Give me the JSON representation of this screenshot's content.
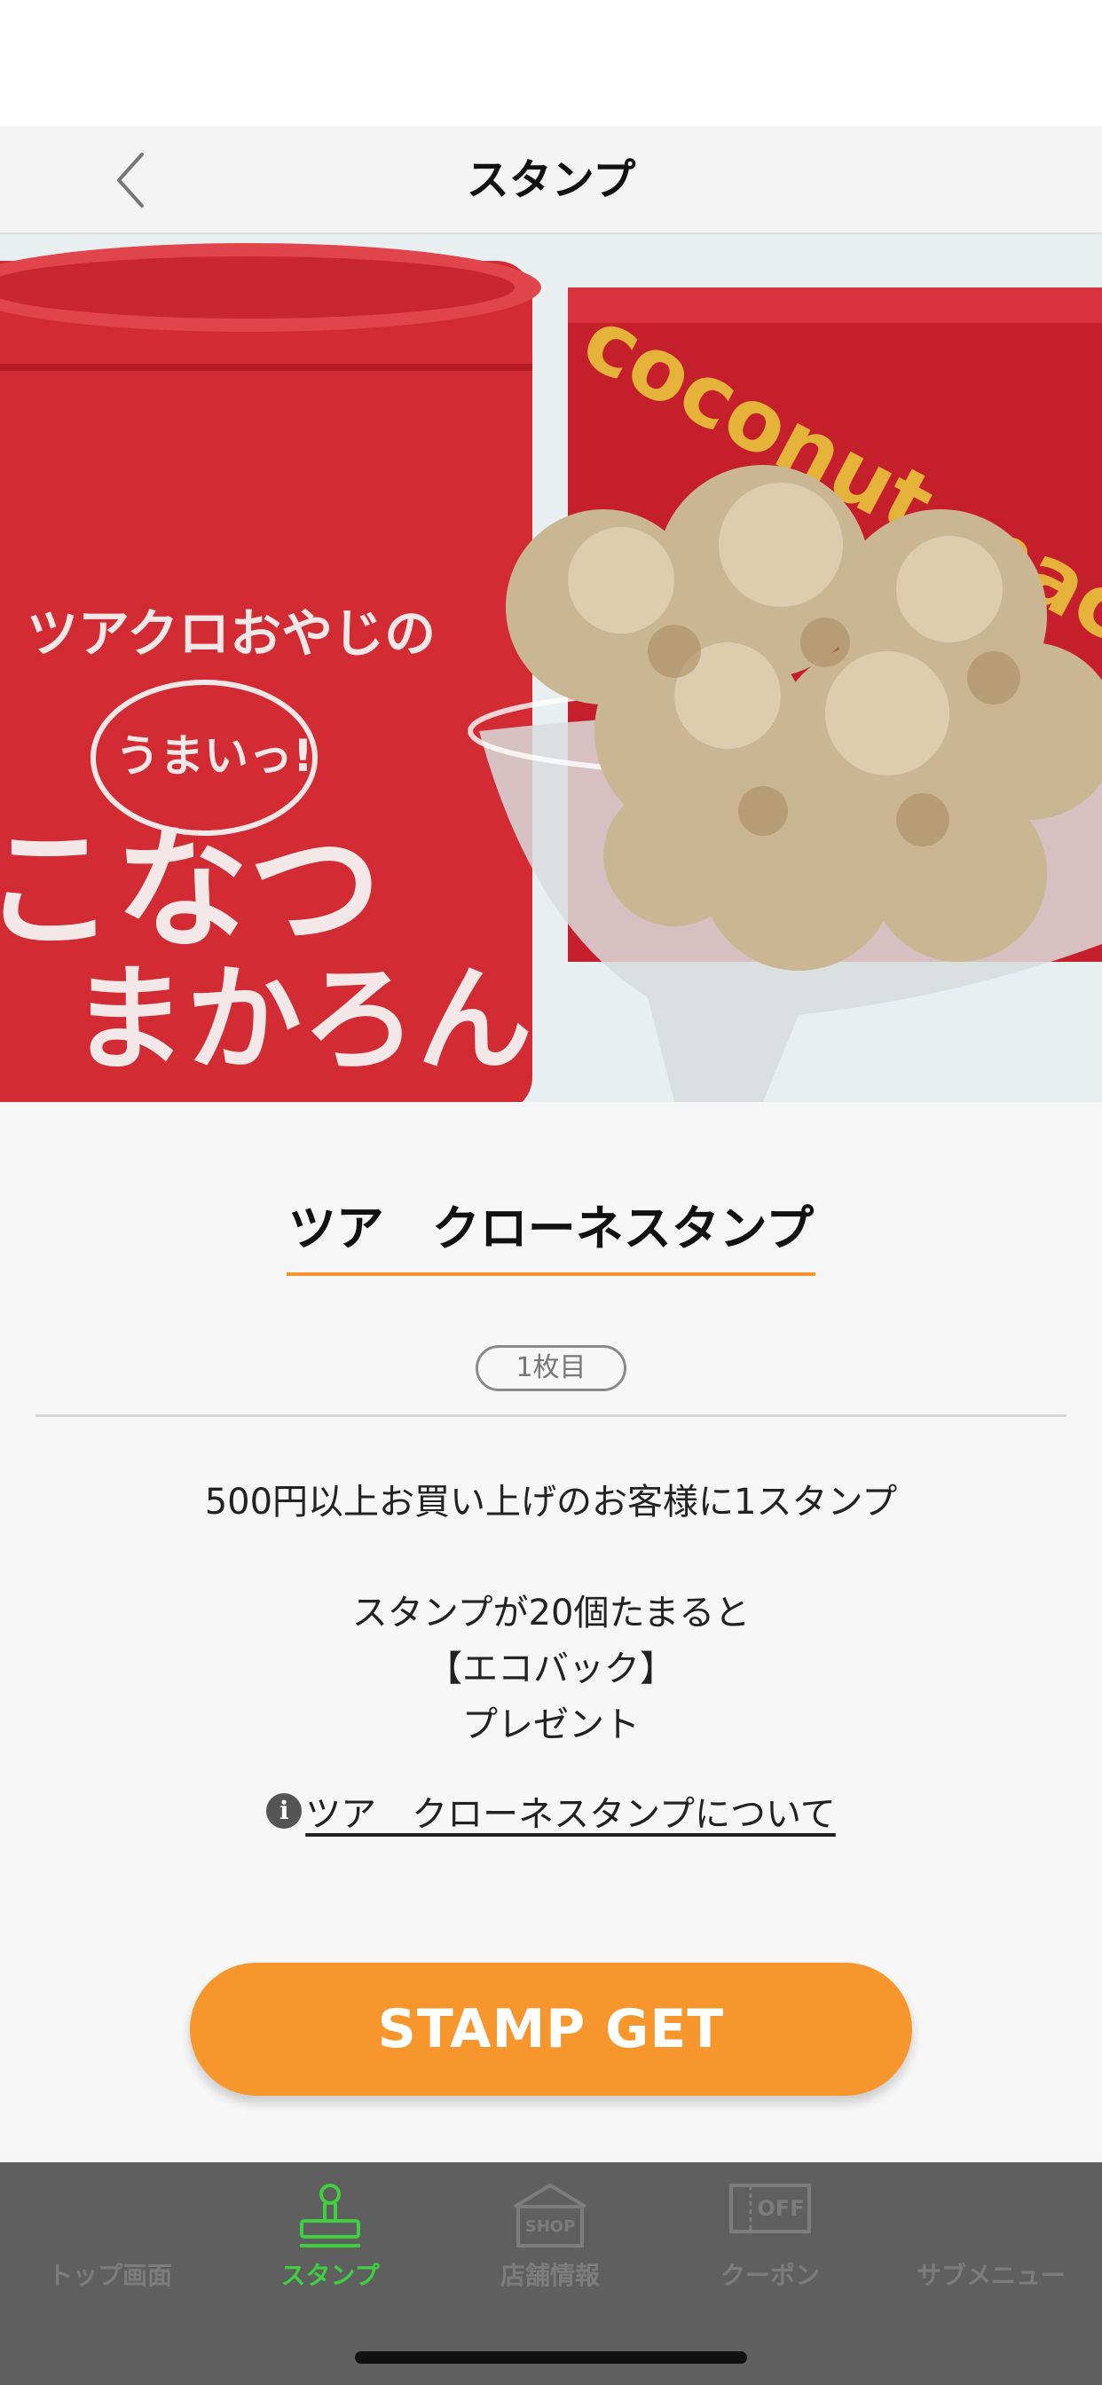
{
  "header": {
    "title": "スタンプ",
    "back_icon": "chevron-left-icon"
  },
  "hero": {
    "alt": "",
    "tin_text_1": "ツアクロおやじの",
    "tin_bubble": "うまいっ!",
    "tin_text_2": "こなつ",
    "tin_text_3": "まかろん",
    "box_text": "coconut macaron"
  },
  "stamp": {
    "title": "ツア　クローネスタンプ",
    "count": "1枚目",
    "description_1": "500円以上お買い上げのお客様に1スタンプ",
    "description_2": "スタンプが20個たまると",
    "description_3": "【エコバック】",
    "description_4": "プレゼント",
    "about_link": "ツア　クローネスタンプについて",
    "button": "STAMP GET"
  },
  "tabbar": {
    "items": [
      {
        "label": "トップ画面",
        "icon": "",
        "active": false
      },
      {
        "label": "スタンプ",
        "icon": "stamp-icon",
        "active": true
      },
      {
        "label": "店舗情報",
        "icon": "shop-icon",
        "active": false
      },
      {
        "label": "クーポン",
        "icon": "coupon-icon",
        "active": false
      },
      {
        "label": "サブメニュー",
        "icon": "",
        "active": false
      }
    ],
    "active_color": "#3ed03e",
    "inactive_color": "#7c7c7c",
    "shop_icon_text": "SHOP",
    "coupon_icon_text": "OFF"
  },
  "colors": {
    "accent": "#f8962e",
    "underline": "#f5952c",
    "tabbar_bg": "#5f5f5f"
  }
}
